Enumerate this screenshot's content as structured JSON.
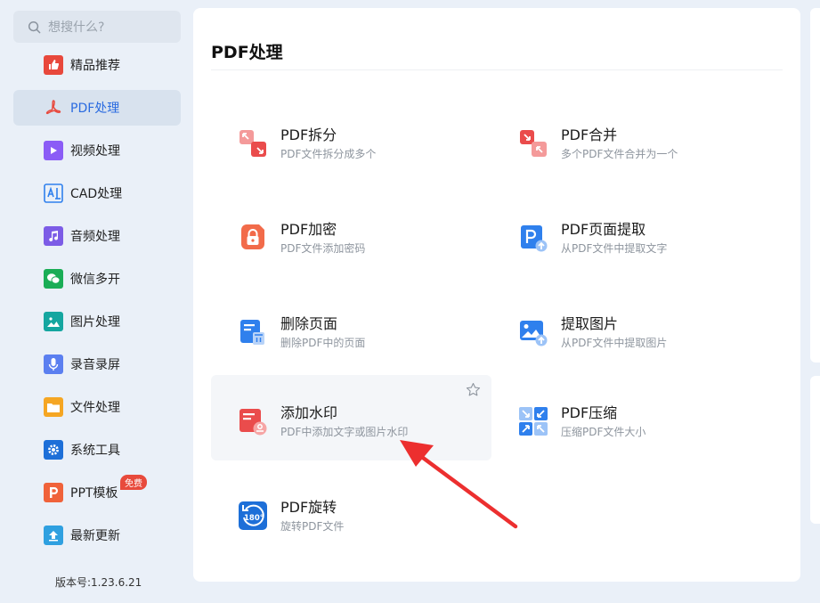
{
  "search": {
    "placeholder": "想搜什么?"
  },
  "sidebar": {
    "items": [
      {
        "label": "精品推荐",
        "icon": "thumbs-up-icon",
        "color": "#e8483c"
      },
      {
        "label": "PDF处理",
        "icon": "pdf-icon",
        "color": "#e8483c",
        "active": true
      },
      {
        "label": "视频处理",
        "icon": "video-play-icon",
        "color": "#8b5cf6"
      },
      {
        "label": "CAD处理",
        "icon": "cad-icon",
        "color": "#2f80ed"
      },
      {
        "label": "音频处理",
        "icon": "music-note-icon",
        "color": "#7c5ce6"
      },
      {
        "label": "微信多开",
        "icon": "wechat-icon",
        "color": "#1aad56"
      },
      {
        "label": "图片处理",
        "icon": "image-icon",
        "color": "#15a6a0"
      },
      {
        "label": "录音录屏",
        "icon": "microphone-icon",
        "color": "#5b7ff0"
      },
      {
        "label": "文件处理",
        "icon": "folder-icon",
        "color": "#f5a623"
      },
      {
        "label": "系统工具",
        "icon": "gear-icon",
        "color": "#1d6fd8"
      },
      {
        "label": "PPT模板",
        "icon": "ppt-icon",
        "color": "#f0623a",
        "badge": "免费"
      },
      {
        "label": "最新更新",
        "icon": "upload-arrow-icon",
        "color": "#2fa0e0"
      }
    ]
  },
  "version": "版本号:1.23.6.21",
  "main": {
    "title": "PDF处理",
    "tools": [
      {
        "title": "PDF拆分",
        "desc": "PDF文件拆分成多个",
        "icon": "pdf-split-icon"
      },
      {
        "title": "PDF合并",
        "desc": "多个PDF文件合并为一个",
        "icon": "pdf-merge-icon"
      },
      {
        "title": "PDF加密",
        "desc": "PDF文件添加密码",
        "icon": "pdf-lock-icon"
      },
      {
        "title": "PDF页面提取",
        "desc": "从PDF文件中提取文字",
        "icon": "pdf-page-extract-icon"
      },
      {
        "title": "删除页面",
        "desc": "删除PDF中的页面",
        "icon": "delete-page-icon"
      },
      {
        "title": "提取图片",
        "desc": "从PDF文件中提取图片",
        "icon": "extract-image-icon"
      },
      {
        "title": "添加水印",
        "desc": "PDF中添加文字或图片水印",
        "icon": "watermark-icon",
        "hover": true
      },
      {
        "title": "PDF压缩",
        "desc": "压缩PDF文件大小",
        "icon": "pdf-compress-icon"
      },
      {
        "title": "PDF旋转",
        "desc": "旋转PDF文件",
        "icon": "pdf-rotate-icon"
      }
    ]
  }
}
